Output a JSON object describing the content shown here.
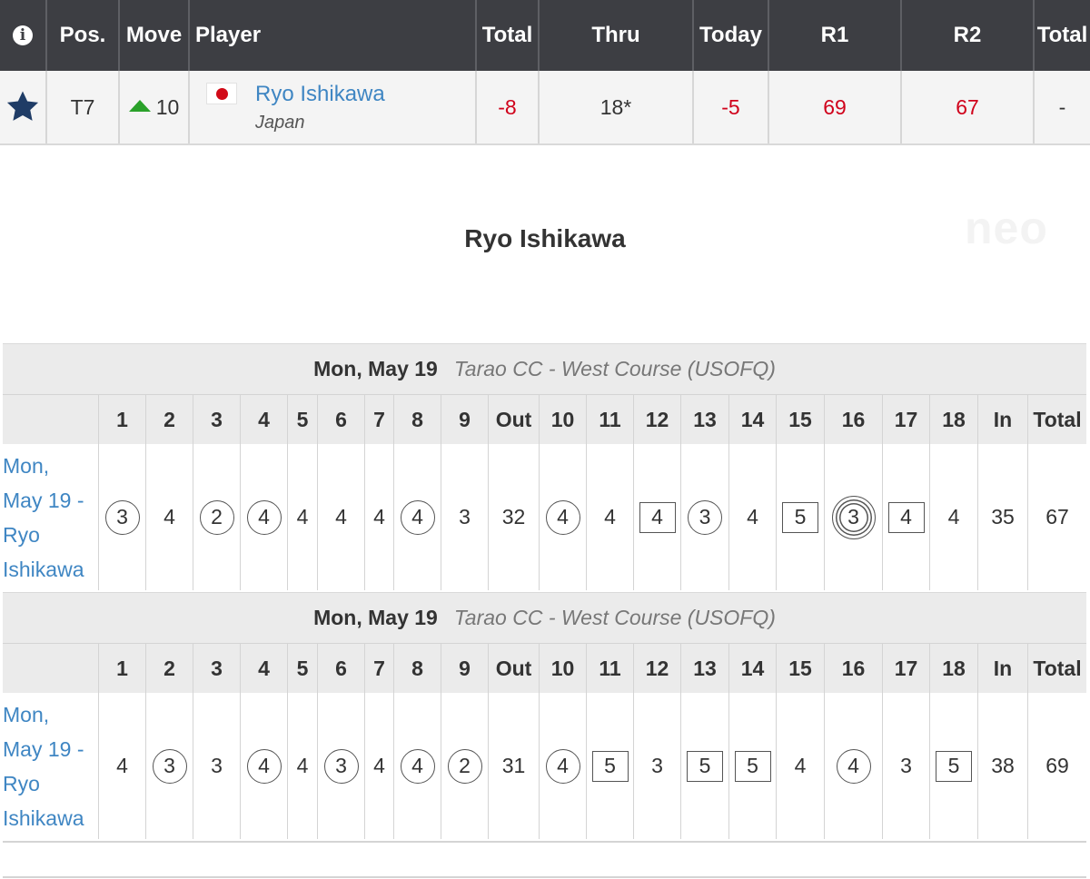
{
  "leaderboard": {
    "headers": {
      "info": "i",
      "pos": "Pos.",
      "move": "Move",
      "player": "Player",
      "total": "Total",
      "thru": "Thru",
      "today": "Today",
      "r1": "R1",
      "r2": "R2",
      "total2": "Total"
    },
    "row": {
      "favorite_icon": "star-icon",
      "pos": "T7",
      "move": "10",
      "move_icon": "up-arrow-icon",
      "flag_icon": "japan-flag-icon",
      "player_name": "Ryo Ishikawa",
      "country": "Japan",
      "total": "-8",
      "thru": "18*",
      "today": "-5",
      "r1": "69",
      "r2": "67",
      "total2": "-"
    }
  },
  "title": "Ryo Ishikawa",
  "watermark": "neo",
  "colors": {
    "header_bg": "#3d3e43",
    "link": "#3f86c3",
    "under_par": "#d0021b",
    "up_arrow": "#2aa12a",
    "star": "#1f3c66"
  },
  "scorecards": [
    {
      "date": "Mon, May 19",
      "course": "Tarao CC - West Course (USOFQ)",
      "headers": [
        "1",
        "2",
        "3",
        "4",
        "5",
        "6",
        "7",
        "8",
        "9",
        "Out",
        "10",
        "11",
        "12",
        "13",
        "14",
        "15",
        "16",
        "17",
        "18",
        "In",
        "Total"
      ],
      "label": "Mon, May 19 - Ryo Ishikawa",
      "label_lines": [
        "Mon,",
        "May 19 -",
        "Ryo",
        "Ishikawa"
      ],
      "scores": [
        "3",
        "4",
        "2",
        "4",
        "4",
        "4",
        "4",
        "4",
        "3",
        "32",
        "4",
        "4",
        "4",
        "3",
        "4",
        "5",
        "3",
        "4",
        "4",
        "35",
        "67"
      ],
      "marks": [
        "birdie",
        "",
        "birdie",
        "birdie",
        "",
        "",
        "",
        "birdie",
        "",
        "",
        "birdie",
        "",
        "bogey",
        "birdie",
        "",
        "bogey",
        "eagle",
        "bogey",
        "",
        "",
        ""
      ]
    },
    {
      "date": "Mon, May 19",
      "course": "Tarao CC - West Course (USOFQ)",
      "headers": [
        "1",
        "2",
        "3",
        "4",
        "5",
        "6",
        "7",
        "8",
        "9",
        "Out",
        "10",
        "11",
        "12",
        "13",
        "14",
        "15",
        "16",
        "17",
        "18",
        "In",
        "Total"
      ],
      "label": "Mon, May 19 - Ryo Ishikawa",
      "label_lines": [
        "Mon,",
        "May 19 -",
        "Ryo",
        "Ishikawa"
      ],
      "scores": [
        "4",
        "3",
        "3",
        "4",
        "4",
        "3",
        "4",
        "4",
        "2",
        "31",
        "4",
        "5",
        "3",
        "5",
        "5",
        "4",
        "4",
        "3",
        "5",
        "38",
        "69"
      ],
      "marks": [
        "",
        "birdie",
        "",
        "birdie",
        "",
        "birdie",
        "",
        "birdie",
        "birdie",
        "",
        "birdie",
        "bogey",
        "",
        "bogey",
        "bogey",
        "",
        "birdie",
        "",
        "bogey",
        "",
        ""
      ]
    }
  ]
}
